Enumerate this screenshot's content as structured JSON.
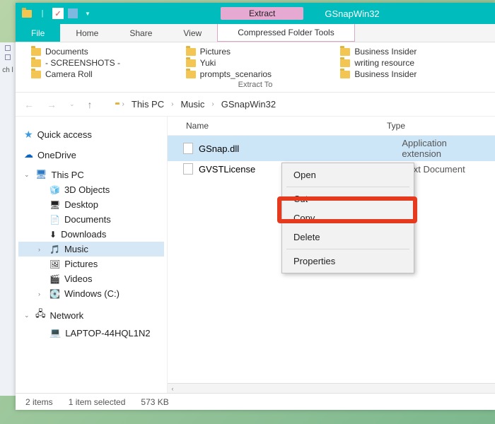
{
  "titlebar": {
    "contextual": "Extract",
    "title": "GSnapWin32"
  },
  "ribbon": {
    "file": "File",
    "home": "Home",
    "share": "Share",
    "view": "View",
    "ctx": "Compressed Folder Tools"
  },
  "extract": {
    "label": "Extract To",
    "folders": [
      [
        "Documents",
        "Pictures",
        "Business Insider"
      ],
      [
        "- SCREENSHOTS -",
        "Yuki",
        "writing resource"
      ],
      [
        "Camera Roll",
        "prompts_scenarios",
        "Business Insider"
      ]
    ]
  },
  "nav": {
    "crumbs": [
      "This PC",
      "Music",
      "GSnapWin32"
    ]
  },
  "tree": {
    "quick_access": "Quick access",
    "onedrive": "OneDrive",
    "this_pc": "This PC",
    "pc_children": [
      "3D Objects",
      "Desktop",
      "Documents",
      "Downloads",
      "Music",
      "Pictures",
      "Videos",
      "Windows (C:)"
    ],
    "selected": "Music",
    "network": "Network",
    "net_children": [
      "LAPTOP-44HQL1N2"
    ]
  },
  "columns": {
    "name": "Name",
    "type": "Type"
  },
  "files": [
    {
      "name": "GSnap.dll",
      "type": "Application extension",
      "selected": true
    },
    {
      "name": "GVSTLicense",
      "type": "Text Document",
      "selected": false
    }
  ],
  "context_menu": [
    "Open",
    "Cut",
    "Copy",
    "Delete",
    "Properties"
  ],
  "status": {
    "count": "2 items",
    "selected": "1 item selected",
    "size": "573 KB"
  },
  "leftstrip": "ch l"
}
